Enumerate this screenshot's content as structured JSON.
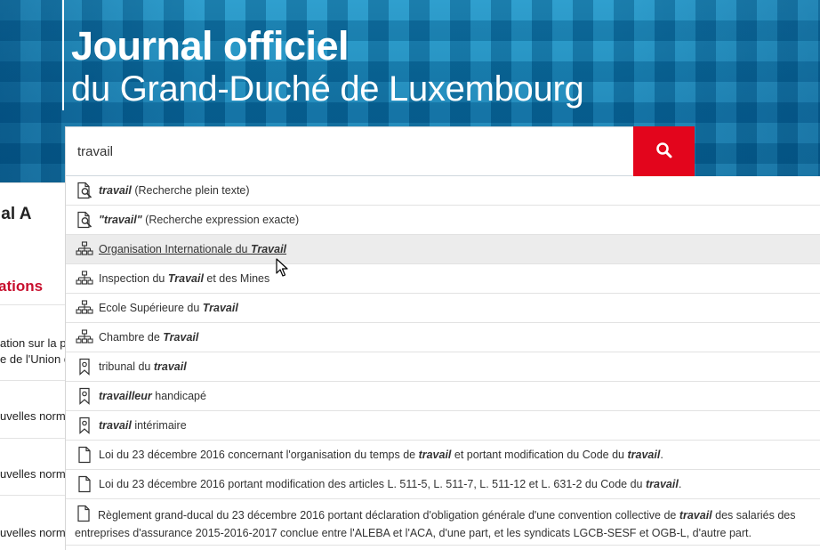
{
  "header": {
    "title_line1": "Journal officiel",
    "title_line2": "du Grand-Duché de Luxembourg",
    "accent_color": "#e3051c",
    "header_color": "#0d86bd"
  },
  "search": {
    "value": "travail",
    "button_icon": "search-icon"
  },
  "left_column": {
    "heading": "ial A",
    "section": "ations",
    "snippets": [
      "ation sur la pro",
      "e de l'Union du",
      "uvelles norme",
      "uvelles norme",
      "uvelles norme"
    ]
  },
  "suggestions": [
    {
      "icon": "document-search-icon",
      "parts": [
        {
          "t": "travail",
          "b": true
        },
        {
          "t": " (Recherche plein texte)",
          "b": false
        }
      ]
    },
    {
      "icon": "document-search-icon",
      "parts": [
        {
          "t": "\"travail\"",
          "b": true
        },
        {
          "t": " (Recherche expression exacte)",
          "b": false
        }
      ]
    },
    {
      "icon": "organization-icon",
      "hover": true,
      "parts": [
        {
          "t": "Organisation Internationale du ",
          "b": false
        },
        {
          "t": "Travail",
          "b": true
        }
      ]
    },
    {
      "icon": "organization-icon",
      "parts": [
        {
          "t": "Inspection du ",
          "b": false
        },
        {
          "t": "Travail",
          "b": true
        },
        {
          "t": " et des Mines",
          "b": false
        }
      ]
    },
    {
      "icon": "organization-icon",
      "parts": [
        {
          "t": "Ecole Supérieure du ",
          "b": false
        },
        {
          "t": "Travail",
          "b": true
        }
      ]
    },
    {
      "icon": "organization-icon",
      "parts": [
        {
          "t": "Chambre de ",
          "b": false
        },
        {
          "t": "Travail",
          "b": true
        }
      ]
    },
    {
      "icon": "bookmark-tag-icon",
      "parts": [
        {
          "t": "tribunal du ",
          "b": false
        },
        {
          "t": "travail",
          "b": true
        }
      ]
    },
    {
      "icon": "bookmark-tag-icon",
      "parts": [
        {
          "t": "travailleur",
          "b": true
        },
        {
          "t": " handicapé",
          "b": false
        }
      ]
    },
    {
      "icon": "bookmark-tag-icon",
      "parts": [
        {
          "t": "travail",
          "b": true
        },
        {
          "t": " intérimaire",
          "b": false
        }
      ]
    },
    {
      "icon": "document-icon",
      "parts": [
        {
          "t": "Loi du 23 décembre 2016 concernant l'organisation du temps de ",
          "b": false
        },
        {
          "t": "travail",
          "b": true
        },
        {
          "t": " et portant modification du Code du ",
          "b": false
        },
        {
          "t": "travail",
          "b": true
        },
        {
          "t": ".",
          "b": false
        }
      ]
    },
    {
      "icon": "document-icon",
      "parts": [
        {
          "t": "Loi du 23 décembre 2016 portant modification des articles L. 511-5, L. 511-7, L. 511-12 et L. 631-2 du Code du ",
          "b": false
        },
        {
          "t": "travail",
          "b": true
        },
        {
          "t": ".",
          "b": false
        }
      ]
    },
    {
      "icon": "document-icon",
      "tall": true,
      "parts": [
        {
          "t": "Règlement grand-ducal du 23 décembre 2016 portant déclaration d'obligation générale d'une convention collective de ",
          "b": false
        },
        {
          "t": "travail",
          "b": true
        },
        {
          "t": " des salariés des entreprises d'assurance 2015-2016-2017 conclue entre l'ALEBA et l'ACA, d'une part, et les syndicats LGCB-SESF et OGB-L, d'autre part.",
          "b": false
        }
      ]
    }
  ]
}
